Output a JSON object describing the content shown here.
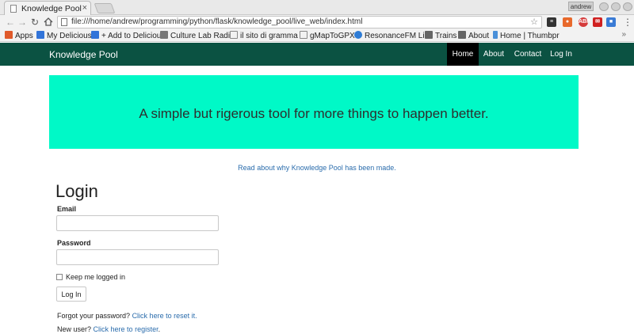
{
  "browser": {
    "tab_title": "Knowledge Pool",
    "tab_close": "×",
    "profile_name": "andrew",
    "url": "file:///home/andrew/programming/python/flask/knowledge_pool/live_web/index.html",
    "bookmarks": [
      {
        "label": "Apps",
        "color": "#e05a2b"
      },
      {
        "label": "My Delicious",
        "color": "#3274d9"
      },
      {
        "label": "+ Add to Deliciou",
        "color": "#3274d9"
      },
      {
        "label": "Culture Lab Radi",
        "color": "#777777"
      },
      {
        "label": "il sito di gramma",
        "color": "#ffffff"
      },
      {
        "label": "gMapToGPX",
        "color": "#ffffff"
      },
      {
        "label": "ResonanceFM Li",
        "color": "#2e7cd6"
      },
      {
        "label": "Trains",
        "color": "#666666"
      },
      {
        "label": "About",
        "color": "#666666"
      },
      {
        "label": "Home | Thumbpr",
        "color": "#4a90d9"
      }
    ],
    "bookmarks_more": "»"
  },
  "nav": {
    "brand": "Knowledge Pool",
    "links": [
      "Home",
      "About",
      "Contact",
      "Log In"
    ],
    "active": "Home",
    "bg_color": "#0b5242"
  },
  "hero": {
    "text": "A simple but rigerous tool for more things to happen better.",
    "bg_color": "#00f9c7"
  },
  "about_link": "Read about why Knowledge Pool has been made.",
  "login": {
    "title": "Login",
    "email_label": "Email",
    "email_value": "",
    "password_label": "Password",
    "password_value": "",
    "remember_label": "Keep me logged in",
    "remember_checked": false,
    "submit_label": "Log In",
    "forgot_prefix": "Forgot your password?",
    "forgot_link": "Click here to reset it.",
    "newuser_prefix": "New user?",
    "newuser_link": "Click here to register",
    "newuser_suffix": "."
  },
  "link_color": "#2a6cac"
}
